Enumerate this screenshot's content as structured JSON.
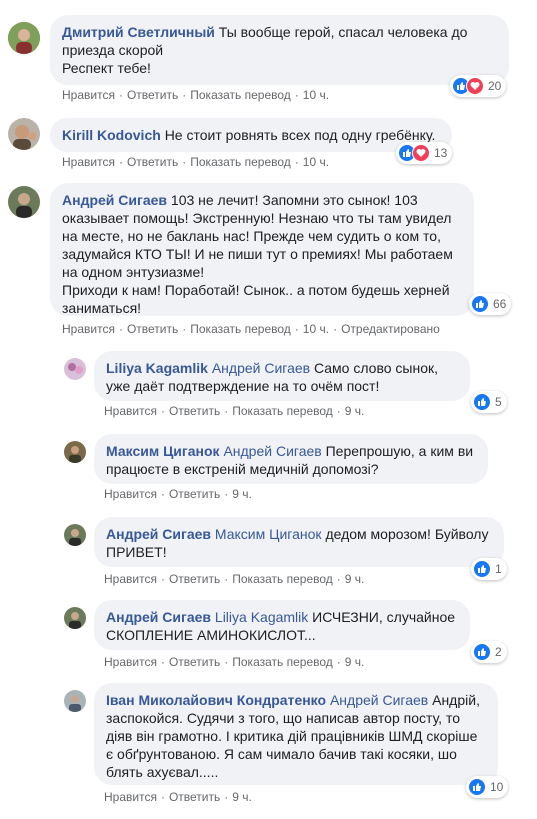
{
  "actions": {
    "like": "Нравится",
    "reply": "Ответить",
    "translate": "Показать перевод",
    "edited": "Отредактировано"
  },
  "comments": [
    {
      "author": "Дмитрий Светличный",
      "mention": "",
      "text": "Ты вообще герой, спасал человека до приезда скорой\nРеспект тебе!",
      "time": "10 ч.",
      "reactions": "20",
      "avatar_color": "#6b8a4a"
    },
    {
      "author": "Kirill Kodovich",
      "mention": "",
      "text": "Не стоит ровнять всех под одну гребёнку.",
      "time": "10 ч.",
      "reactions": "13",
      "avatar_color": "#9a7a5a"
    },
    {
      "author": "Андрей Сигаев",
      "mention": "",
      "text": "103 не лечит! Запомни это сынок! 103 оказывает помощь! Экстренную! Незнаю что ты там увидел на месте, но не баклань нас! Прежде чем судить о ком то, задумайся КТО ТЫ! И не пиши тут о премиях! Мы работаем на одном энтузиазме!\nПриходи к нам! Поработай! Сынок.. а потом будешь херней заниматься!",
      "time": "10 ч.",
      "reactions": "66",
      "avatar_color": "#5a6a4a"
    },
    {
      "author": "Liliya Kagamlik",
      "mention": "Андрей Сигаев",
      "text": "Само слово сынок, уже даёт подтверждение на то очём пост!",
      "time": "9 ч.",
      "reactions": "5",
      "avatar_color": "#c9a0c0"
    },
    {
      "author": "Максим Циганок",
      "mention": "Андрей Сигаев",
      "text": "Перепрошую, а ким ви працюєте в екстреній медичній допомозі?",
      "time": "9 ч.",
      "reactions": "",
      "avatar_color": "#6a5a3a"
    },
    {
      "author": "Андрей Сигаев",
      "mention": "Максим Циганок",
      "text": "дедом морозом! Буйволу ПРИВЕТ!",
      "time": "9 ч.",
      "reactions": "1",
      "avatar_color": "#5a6a4a"
    },
    {
      "author": "Андрей Сигаев",
      "mention": "Liliya Kagamlik",
      "text": "ИСЧЕЗНИ, случайное СКОПЛЕНИЕ АМИНОКИСЛОТ...",
      "time": "9 ч.",
      "reactions": "2",
      "avatar_color": "#5a6a4a"
    },
    {
      "author": "Іван Миколайович Кондратенко",
      "mention": "Андрей Сигаев",
      "text": "Андрій, заспокойся. Судячи з того, що написав автор посту, то діяв він грамотно. І критика дій працівників ШМД скоріше є обґрунтованою. Я сам чимало бачив такі косяки, шо блять ахуєвал.....",
      "time": "9 ч.",
      "reactions": "10",
      "avatar_color": "#8a9aa0"
    }
  ]
}
